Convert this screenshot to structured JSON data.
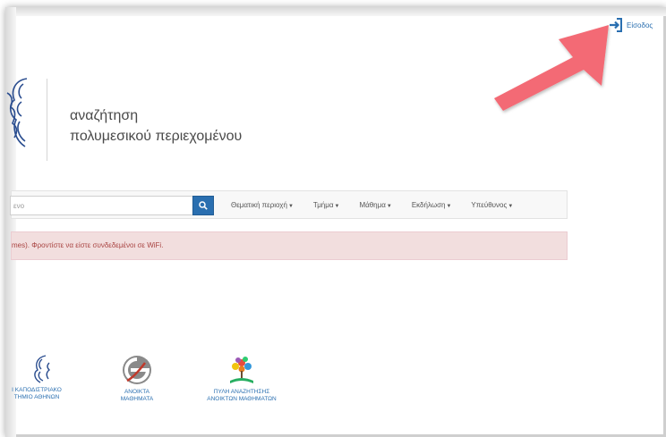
{
  "header": {
    "login_label": "Είσοδος"
  },
  "site": {
    "title_line1": "αναζήτηση",
    "title_line2": "πολυμεσικού περιεχομένου"
  },
  "search": {
    "value": "ενο"
  },
  "nav": {
    "items": [
      {
        "label": "Θεματική περιοχή"
      },
      {
        "label": "Τμήμα"
      },
      {
        "label": "Μάθημα"
      },
      {
        "label": "Εκδήλωση"
      },
      {
        "label": "Υπεύθυνος"
      }
    ]
  },
  "alert": {
    "text": "mes). Φροντίστε να είστε συνδεδεμένοι σε WiFi."
  },
  "partners": [
    {
      "line1": "Ι ΚΑΠΟΔΙΣΤΡΙΑΚΟ",
      "line2": "ΤΗΜΙΟ ΑΘΗΝΩΝ"
    },
    {
      "line1": "ΑΝΟΙΚΤΑ",
      "line2": "ΜΑΘΗΜΑΤΑ"
    },
    {
      "line1": "ΠΥΛΗ ΑΝΑΖΗΤΗΣΗΣ",
      "line2": "ΑΝΟΙΚΤΩΝ ΜΑΘΗΜΑΤΩΝ"
    }
  ],
  "colors": {
    "accent": "#2a6fb0",
    "arrow": "#f36b75",
    "alert_bg": "#f2dede",
    "alert_text": "#a94442"
  }
}
